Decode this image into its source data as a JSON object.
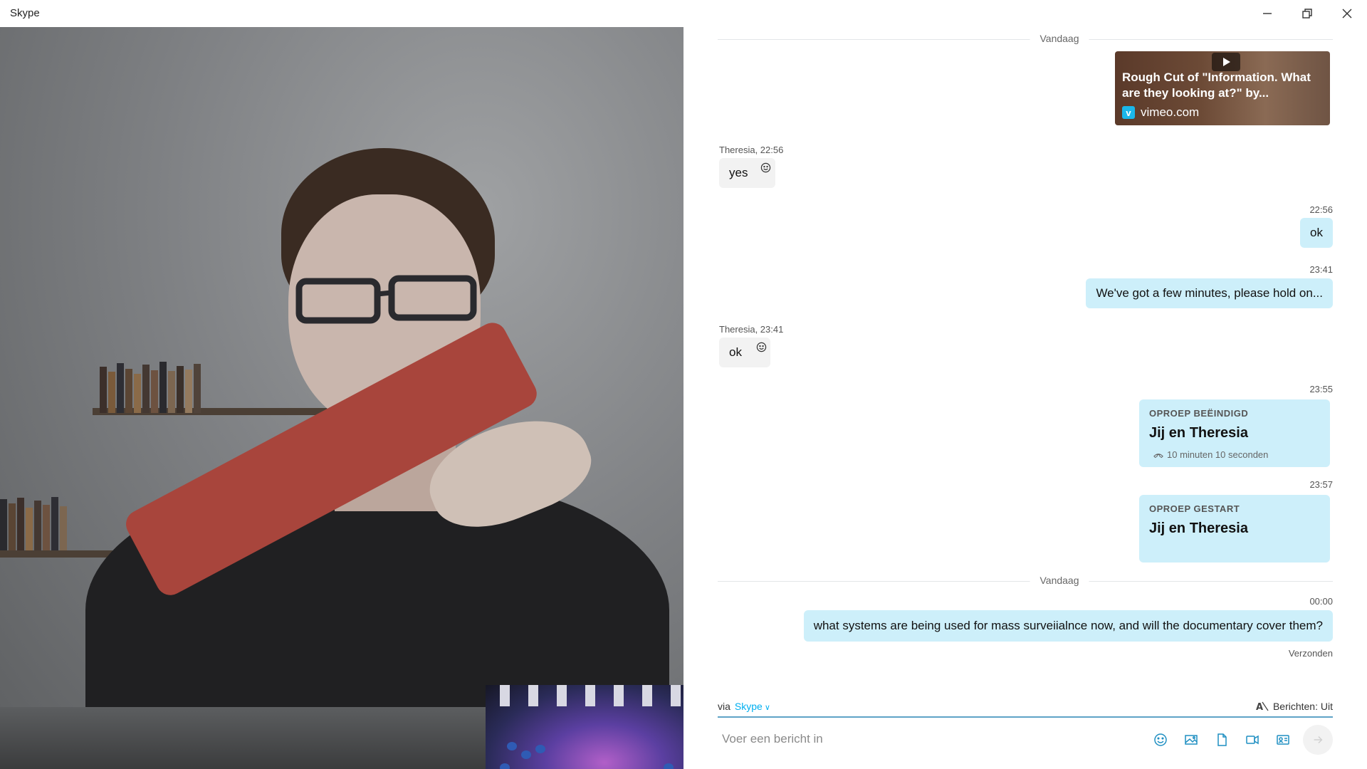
{
  "window": {
    "title": "Skype"
  },
  "chat": {
    "divider_today": "Vandaag",
    "link_preview": {
      "title": "Rough Cut of \"Information. What are they looking at?\" by...",
      "domain": "vimeo.com",
      "logo_letter": "v"
    },
    "messages": [
      {
        "sender": "Theresia, 22:56",
        "text": "yes"
      },
      {
        "time": "22:56",
        "text": "ok"
      },
      {
        "time": "23:41",
        "text": "We've got a few minutes, please hold on..."
      },
      {
        "sender": "Theresia, 23:41",
        "text": "ok"
      }
    ],
    "call_ended": {
      "time": "23:55",
      "header": "OPROEP BEËINDIGD",
      "participants": "Jij en Theresia",
      "duration": "10 minuten 10 seconden"
    },
    "call_started": {
      "time": "23:57",
      "header": "OPROEP GESTART",
      "participants": "Jij en Theresia"
    },
    "divider_today_2": "Vandaag",
    "last_message": {
      "time": "00:00",
      "text": "what systems are being used for mass surveiialnce now, and will the documentary cover them?",
      "status": "Verzonden"
    }
  },
  "composer": {
    "via_label": "via",
    "via_service": "Skype",
    "translation_label": "Berichten: Uit",
    "placeholder": "Voer een bericht in"
  },
  "colors": {
    "accent": "#00aff0",
    "outgoing_bubble": "#cdeffa",
    "incoming_bubble": "#f2f2f2"
  }
}
